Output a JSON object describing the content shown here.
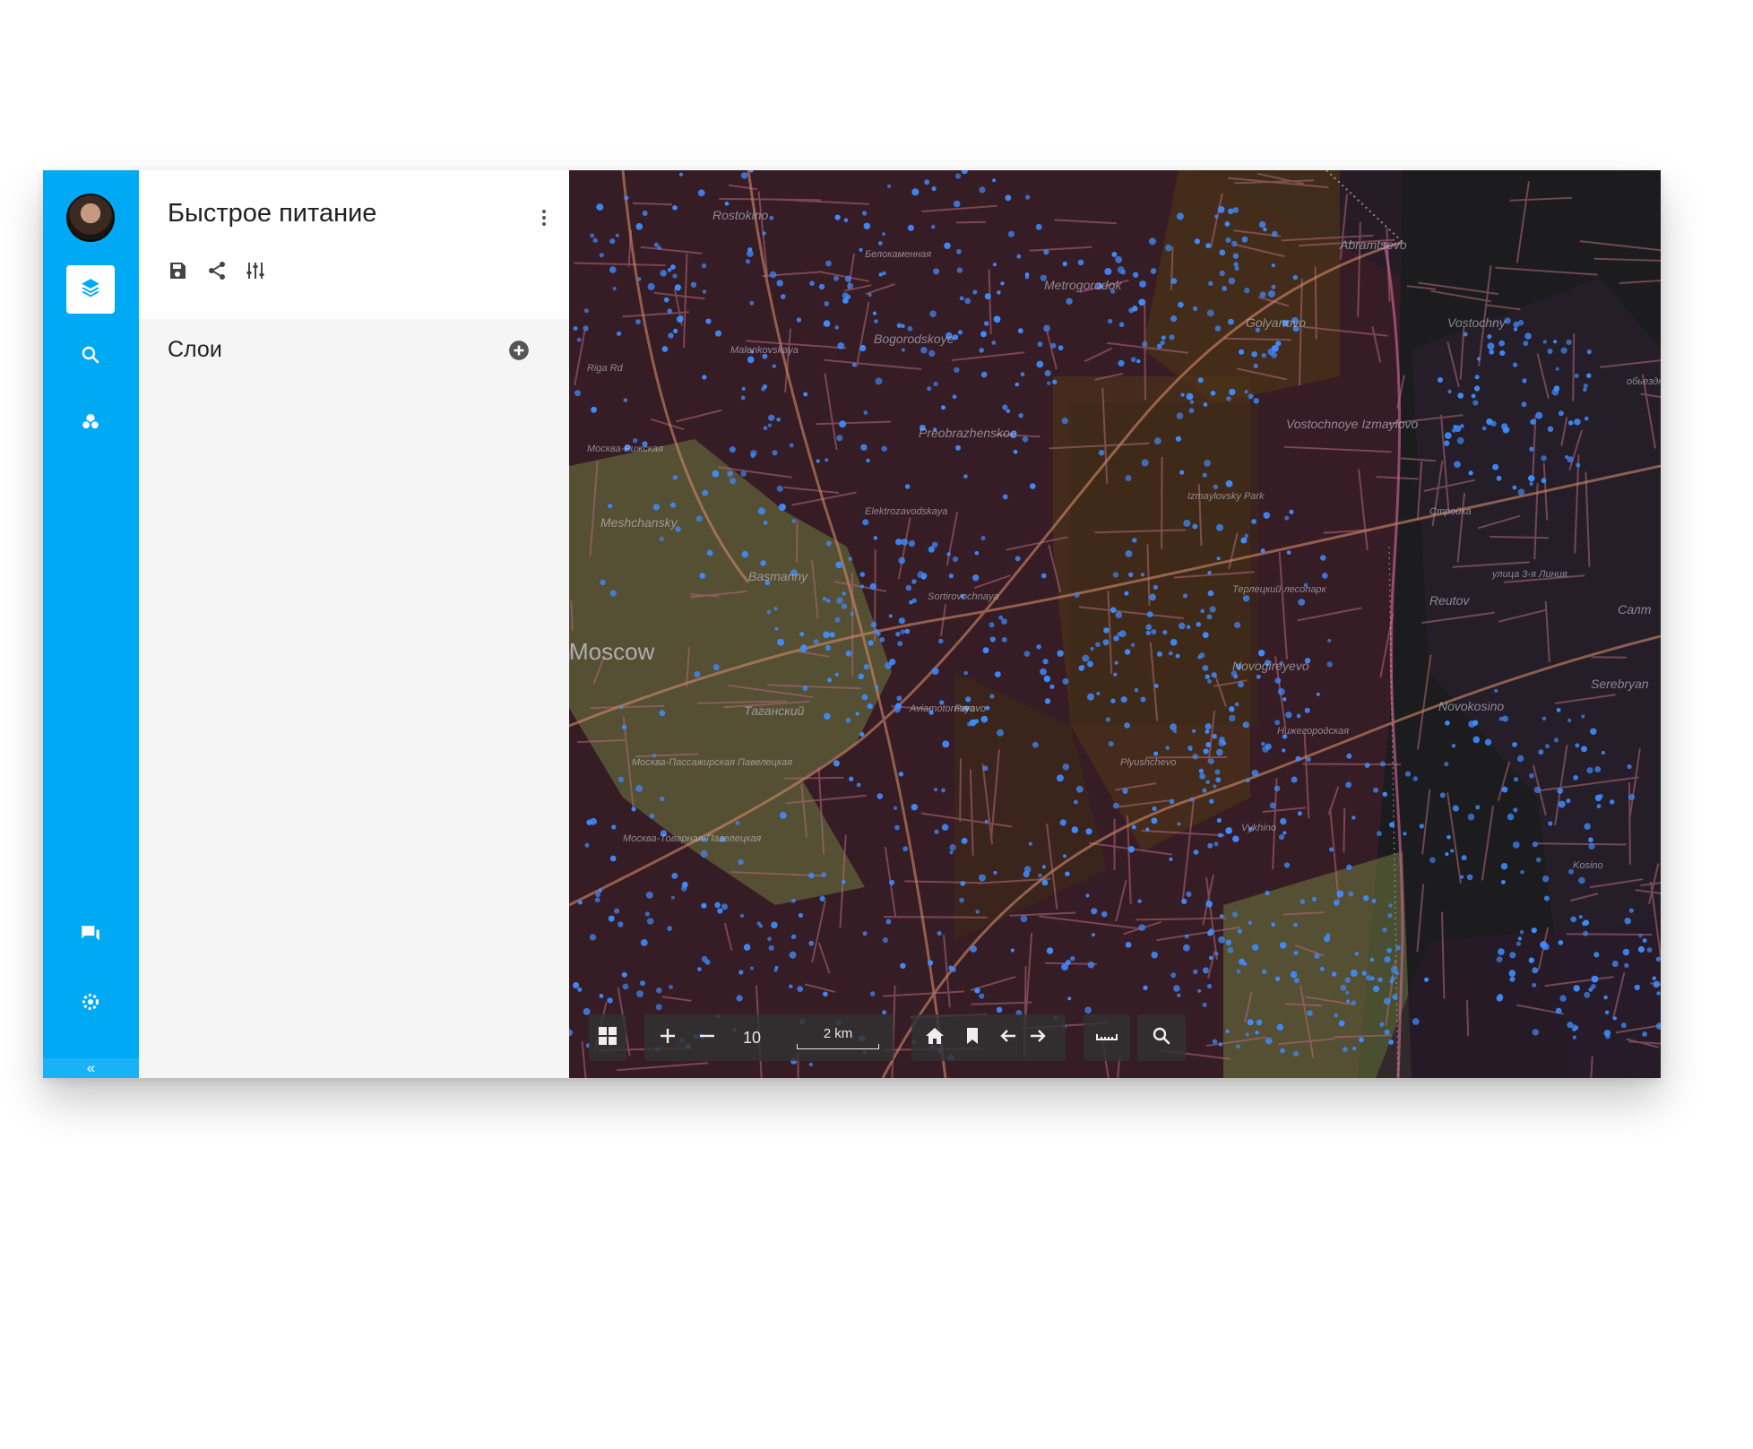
{
  "sidebar": {
    "icons": [
      "avatar",
      "layers-icon",
      "search-icon",
      "layers-group-icon",
      "chat-icon",
      "settings-icon"
    ],
    "collapse_label": "«"
  },
  "panel": {
    "title": "Быстрое питание",
    "layers_label": "Слои",
    "tools": [
      "save-icon",
      "share-icon",
      "tune-icon"
    ]
  },
  "map": {
    "places": [
      {
        "name": "Rostokino",
        "cls": "place"
      },
      {
        "name": "Белокаменная",
        "cls": "place small"
      },
      {
        "name": "Abramtsevo",
        "cls": "place"
      },
      {
        "name": "Metrogorodok",
        "cls": "place"
      },
      {
        "name": "Golyanovo",
        "cls": "place"
      },
      {
        "name": "Vostochny",
        "cls": "place"
      },
      {
        "name": "Bogorodskoye",
        "cls": "place"
      },
      {
        "name": "Malenkovskaya",
        "cls": "place small"
      },
      {
        "name": "Preobrazhenskoe",
        "cls": "place"
      },
      {
        "name": "Vostochnoye Izmaylovo",
        "cls": "place"
      },
      {
        "name": "Izmaylovsky Park",
        "cls": "place small"
      },
      {
        "name": "Москва-Рижская",
        "cls": "place small"
      },
      {
        "name": "Meshchansky",
        "cls": "place"
      },
      {
        "name": "Elektrozavodskaya",
        "cls": "place small"
      },
      {
        "name": "Стройка",
        "cls": "place small"
      },
      {
        "name": "Basmanny",
        "cls": "place"
      },
      {
        "name": "Sortirovochnaya",
        "cls": "place small"
      },
      {
        "name": "Терлецкий лесопарк",
        "cls": "place small"
      },
      {
        "name": "Reutov",
        "cls": "place"
      },
      {
        "name": "улица 3-я Линия",
        "cls": "place small"
      },
      {
        "name": "Салт",
        "cls": "place"
      },
      {
        "name": "Moscow",
        "cls": "place big"
      },
      {
        "name": "Novogireyevo",
        "cls": "place"
      },
      {
        "name": "Aviamotornaya",
        "cls": "place small"
      },
      {
        "name": "Serebryan",
        "cls": "place"
      },
      {
        "name": "Novokosino",
        "cls": "place"
      },
      {
        "name": "Таганский",
        "cls": "place"
      },
      {
        "name": "Perovo",
        "cls": "place small"
      },
      {
        "name": "Plyushchevo",
        "cls": "place small"
      },
      {
        "name": "Москва-Пассажирская Павелецкая",
        "cls": "place small"
      },
      {
        "name": "Нижегородская",
        "cls": "place small"
      },
      {
        "name": "Vykhino",
        "cls": "place small"
      },
      {
        "name": "Москва-Товарная-Павелецкая",
        "cls": "place small"
      },
      {
        "name": "Kosino",
        "cls": "place small"
      },
      {
        "name": "Riga Rd",
        "cls": "place small"
      },
      {
        "name": "обьездное",
        "cls": "place small"
      }
    ],
    "colors": {
      "points": "#3f8cff",
      "roads": "#b36a7a",
      "zone_green": "#7d8c4d",
      "zone_brown": "#5a3d22"
    }
  },
  "toolbar": {
    "zoom": "10",
    "scale": "2 km",
    "buttons": [
      "grid-icon",
      "zoom-in-icon",
      "zoom-out-icon",
      "home-icon",
      "bookmark-icon",
      "back-icon",
      "forward-icon",
      "ruler-icon",
      "search-icon"
    ]
  }
}
